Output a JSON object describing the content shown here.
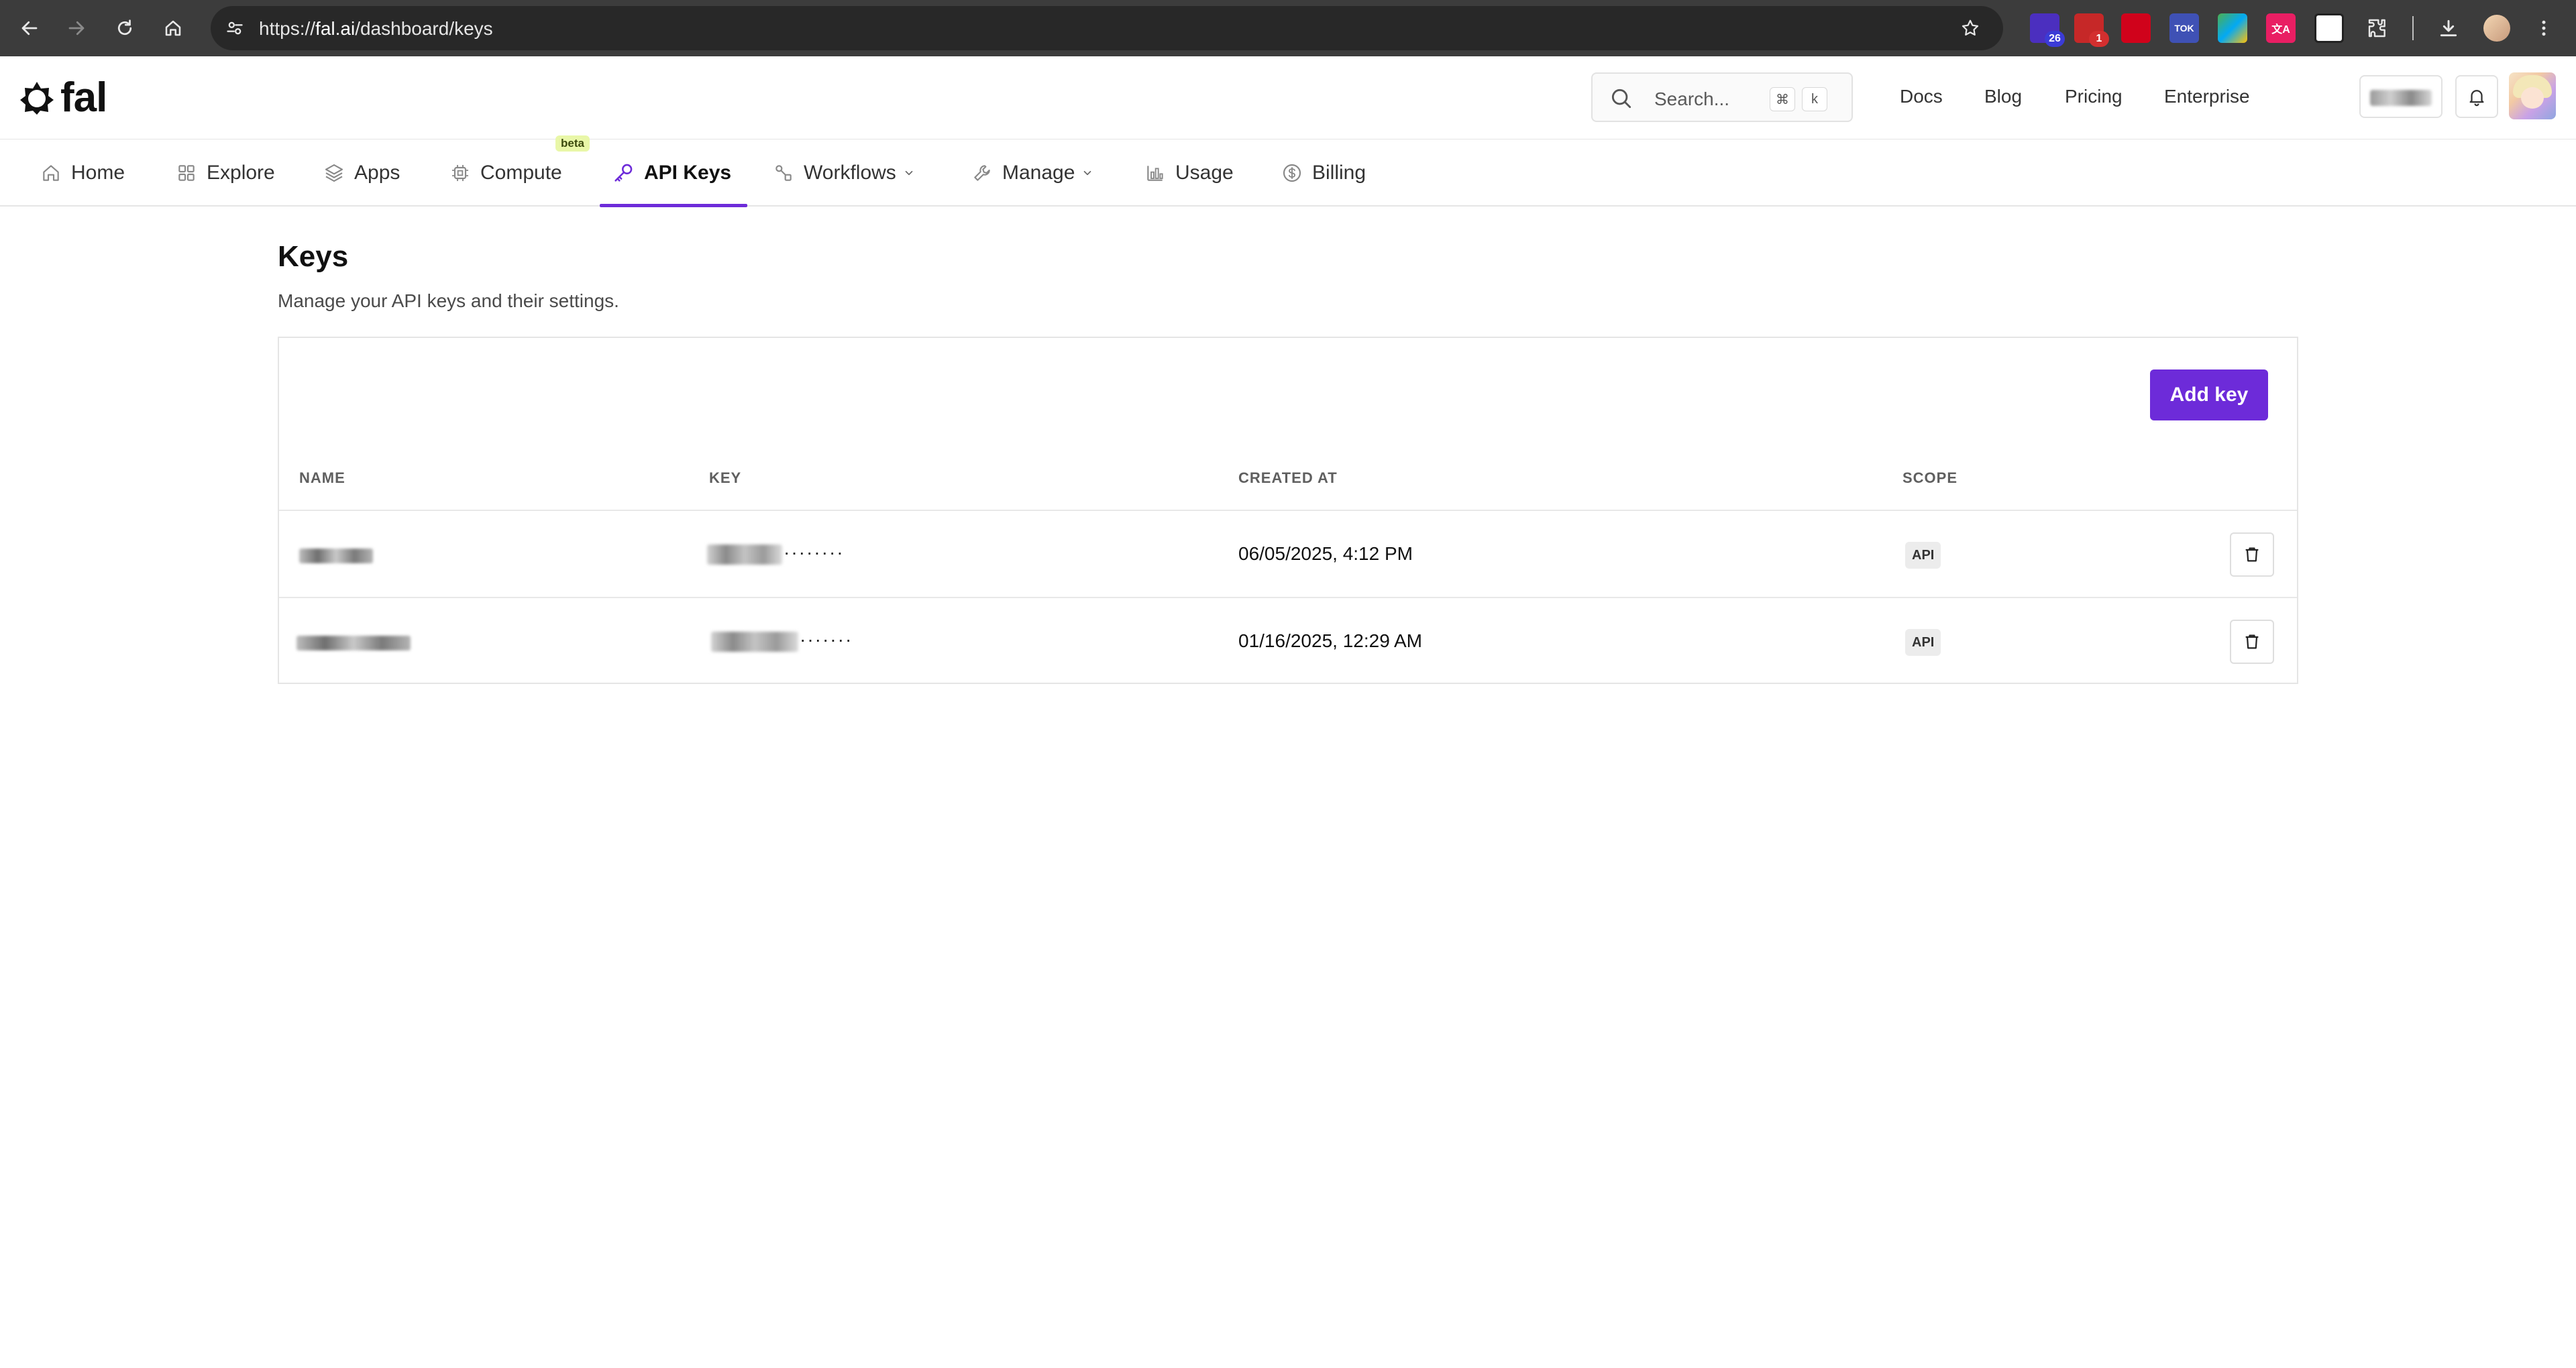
{
  "browser": {
    "url_prefix": "https://",
    "url_host": "fal.ai",
    "url_path": "/dashboard/keys",
    "extensions": [
      {
        "name": "ext-1",
        "badge": "26",
        "color": "#4b2fbf"
      },
      {
        "name": "ext-2",
        "badge": "1",
        "color": "#c62828"
      },
      {
        "name": "ext-3",
        "badge": "",
        "color": "#d0021b"
      },
      {
        "name": "ext-4",
        "badge": "",
        "color": "#3f51b5",
        "text": "TOK"
      },
      {
        "name": "ext-5",
        "badge": "",
        "color": "#2e7d32"
      },
      {
        "name": "ext-6",
        "badge": "",
        "color": "#e91e63",
        "text": "文A"
      },
      {
        "name": "ext-7",
        "badge": "",
        "color": "#ffffff"
      }
    ]
  },
  "header": {
    "logo_text": "fal",
    "search_placeholder": "Search...",
    "search_shortcut": [
      "⌘",
      "k"
    ],
    "links": [
      "Docs",
      "Blog",
      "Pricing",
      "Enterprise"
    ]
  },
  "tabs": [
    {
      "label": "Home",
      "icon": "home-icon"
    },
    {
      "label": "Explore",
      "icon": "grid-icon"
    },
    {
      "label": "Apps",
      "icon": "layers-icon"
    },
    {
      "label": "Compute",
      "icon": "cpu-icon",
      "badge": "beta"
    },
    {
      "label": "API Keys",
      "icon": "key-icon",
      "active": true
    },
    {
      "label": "Workflows",
      "icon": "workflow-icon",
      "dropdown": true
    },
    {
      "label": "Manage",
      "icon": "wrench-icon",
      "dropdown": true
    },
    {
      "label": "Usage",
      "icon": "bar-chart-icon"
    },
    {
      "label": "Billing",
      "icon": "dollar-icon"
    }
  ],
  "page": {
    "title": "Keys",
    "subtitle": "Manage your API keys and their settings.",
    "add_button": "Add key"
  },
  "table": {
    "headers": [
      "NAME",
      "KEY",
      "CREATED AT",
      "SCOPE"
    ],
    "rows": [
      {
        "key_mask": "········",
        "created_at": "06/05/2025, 4:12 PM",
        "scope": "API"
      },
      {
        "key_mask": "·······",
        "created_at": "01/16/2025, 12:29 AM",
        "scope": "API"
      }
    ]
  },
  "colors": {
    "accent": "#6d2bd9",
    "browser_bar": "#3c3c3c"
  }
}
